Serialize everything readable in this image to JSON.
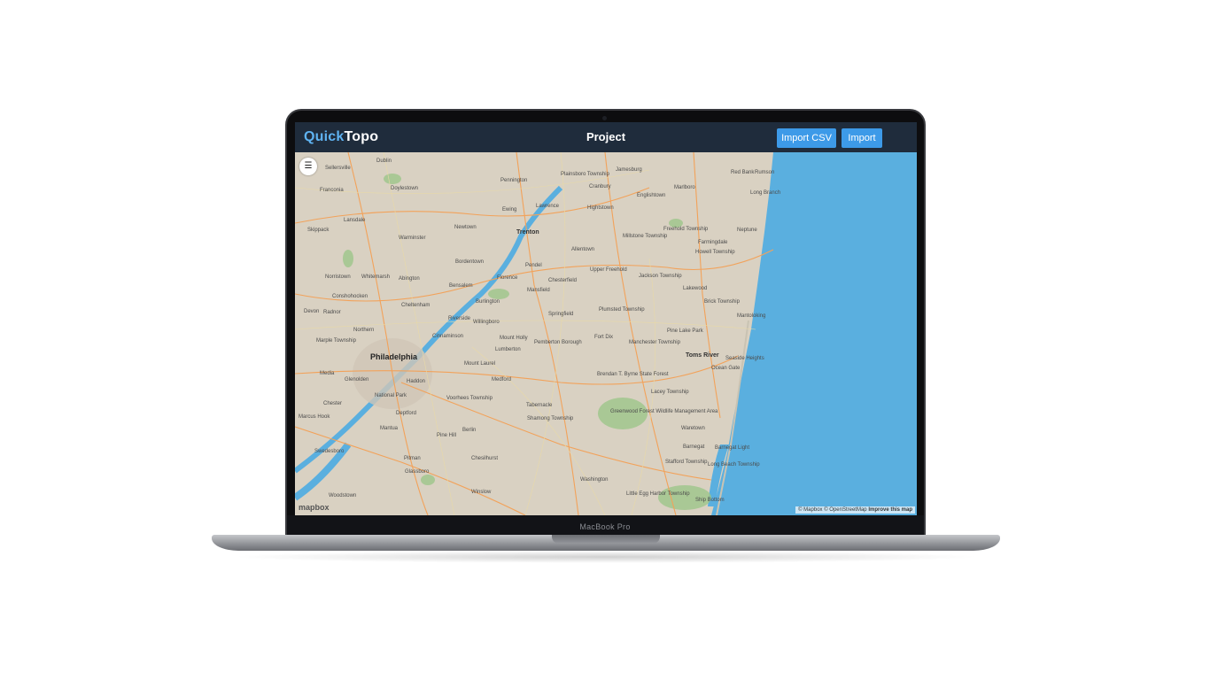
{
  "device": {
    "label": "MacBook Pro"
  },
  "app": {
    "brand_left": "Quick",
    "brand_right": "Topo",
    "title": "Project",
    "buttons": {
      "import_csv": "Import CSV",
      "import": "Import"
    }
  },
  "map": {
    "logo": "mapbox",
    "attribution": "© Mapbox © OpenStreetMap",
    "improve": "Improve this map",
    "labels": [
      "Sellersville",
      "Dublin",
      "Plainsboro Township",
      "Jamesburg",
      "Red Bank",
      "Rumson",
      "Franconia",
      "Doylestown",
      "Pennington",
      "Cranbury",
      "Marlboro",
      "Long Branch",
      "Englishtown",
      "Hightstown",
      "Lansdale",
      "Ewing",
      "Lawrence",
      "Newtown",
      "Trenton",
      "Neptune",
      "Skippack",
      "Warminster",
      "Millstone Township",
      "Freehold Township",
      "Howell Township",
      "Farmingdale",
      "Allentown",
      "Pendel",
      "Bordentown",
      "Norristown",
      "Whitemarsh",
      "Abington",
      "Upper Freehold",
      "Bensalem",
      "Florence",
      "Chesterfield",
      "Jackson Township",
      "Conshohocken",
      "Mansfield",
      "Lakewood",
      "Cheltenham",
      "Burlington",
      "Plumsted Township",
      "Brick Township",
      "Devon",
      "Radnor",
      "Riverside",
      "Willingboro",
      "Springfield",
      "Mantoloking",
      "Northern",
      "Cinnaminson",
      "Mount Holly",
      "Fort Dix",
      "Pine Lake Park",
      "Marple Township",
      "Pemberton Borough",
      "Lumberton",
      "Manchester Township",
      "Philadelphia",
      "Toms River",
      "Media",
      "Mount Laurel",
      "Ocean Gate",
      "Seaside Heights",
      "Glenolden",
      "Haddon",
      "Brendan T. Byrne State Forest",
      "Medford",
      "Lacey Township",
      "National Park",
      "Voorhees Township",
      "Chester",
      "Tabernacle",
      "Greenwood Forest Wildlife Management Area",
      "Marcus Hook",
      "Deptford",
      "Shamong Township",
      "Mantua",
      "Berlin",
      "Waretown",
      "Pine Hill",
      "Barnegat",
      "Barnegat Light",
      "Swedesboro",
      "Pitman",
      "Chesilhurst",
      "Stafford Township",
      "Glassboro",
      "Washington",
      "Long Beach Township",
      "Winslow",
      "Little Egg Harbor Township",
      "Woodstown",
      "Ship Bottom"
    ]
  }
}
